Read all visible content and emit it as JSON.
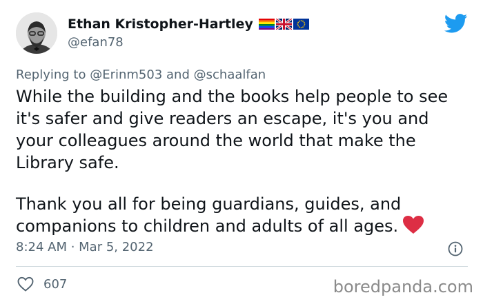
{
  "author": {
    "name": "Ethan Kristopher-Hartley",
    "handle": "@efan78",
    "flags": [
      "rainbow-flag-icon",
      "uk-flag-icon",
      "eu-flag-icon"
    ]
  },
  "reply": {
    "prefix": "Replying to",
    "mention1": "@Erinm503",
    "joiner": "and",
    "mention2": "@schaalfan"
  },
  "tweet": {
    "paragraph1": "While the building and the books help people to see it's safer and give readers an escape, it's you and your colleagues around the world that make the Library safe.",
    "paragraph2": "Thank you all for being guardians, guides, and companions to children and adults of all ages.",
    "timestamp": "8:24 AM · Mar 5, 2022"
  },
  "engagement": {
    "likes": "607"
  },
  "watermark": "boredpanda.com",
  "colors": {
    "twitter_blue": "#1d9bf0",
    "secondary_text": "#536471",
    "heart_red": "#e0245e"
  }
}
